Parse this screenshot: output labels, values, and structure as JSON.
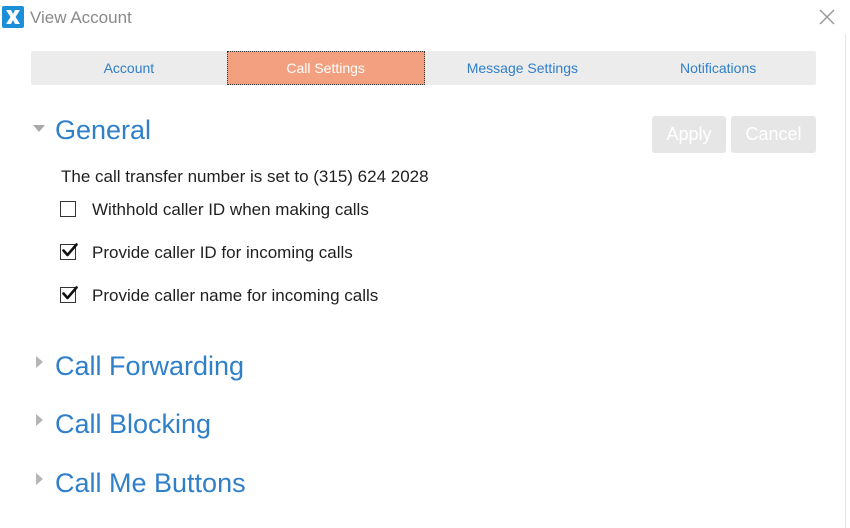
{
  "window": {
    "title": "View Account",
    "logo_icon": "x-logo-icon",
    "logo_color": "#1b8fd8"
  },
  "tabs": [
    {
      "label": "Account",
      "active": false
    },
    {
      "label": "Call Settings",
      "active": true
    },
    {
      "label": "Message Settings",
      "active": false
    },
    {
      "label": "Notifications",
      "active": false
    }
  ],
  "colors": {
    "accent_link": "#2f7fc9",
    "active_tab": "#f2a07f"
  },
  "general": {
    "title": "General",
    "expanded": true,
    "apply_label": "Apply",
    "cancel_label": "Cancel",
    "transfer_text": "The call transfer number is set to (315) 624 2028",
    "options": [
      {
        "label": "Withhold caller ID when making calls",
        "checked": false
      },
      {
        "label": "Provide caller ID for incoming calls",
        "checked": true
      },
      {
        "label": "Provide caller name for incoming calls",
        "checked": true
      }
    ]
  },
  "collapsed_sections": [
    {
      "title": "Call Forwarding",
      "expanded": false
    },
    {
      "title": "Call Blocking",
      "expanded": false
    },
    {
      "title": "Call Me Buttons",
      "expanded": false
    }
  ]
}
